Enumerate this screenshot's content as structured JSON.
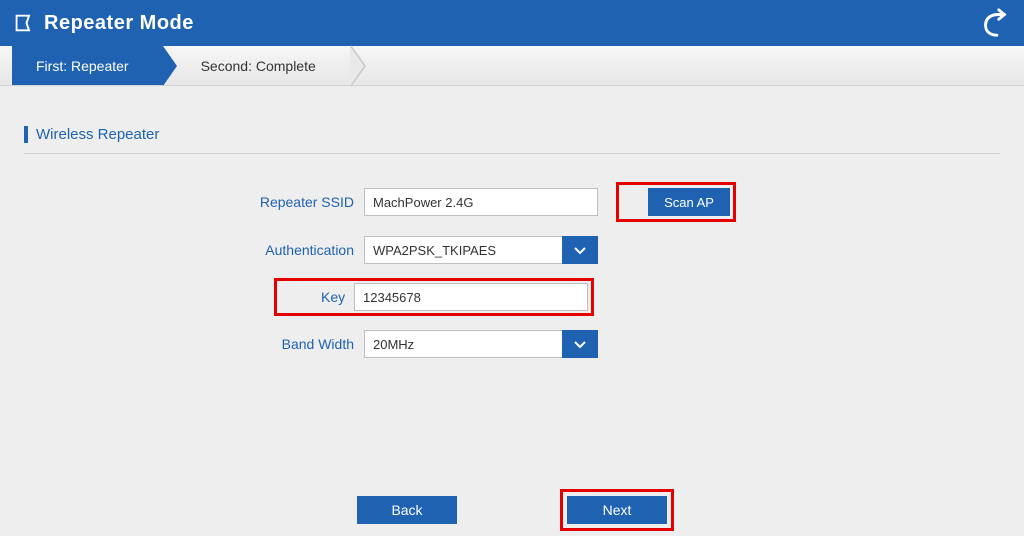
{
  "header": {
    "title": "Repeater Mode"
  },
  "breadcrumb": {
    "step1": "First: Repeater",
    "step2": "Second: Complete"
  },
  "section": {
    "title": "Wireless Repeater"
  },
  "form": {
    "ssid_label": "Repeater SSID",
    "ssid_value": "MachPower 2.4G",
    "scan_label": "Scan AP",
    "auth_label": "Authentication",
    "auth_value": "WPA2PSK_TKIPAES",
    "key_label": "Key",
    "key_value": "12345678",
    "bw_label": "Band Width",
    "bw_value": "20MHz"
  },
  "buttons": {
    "back": "Back",
    "next": "Next"
  }
}
